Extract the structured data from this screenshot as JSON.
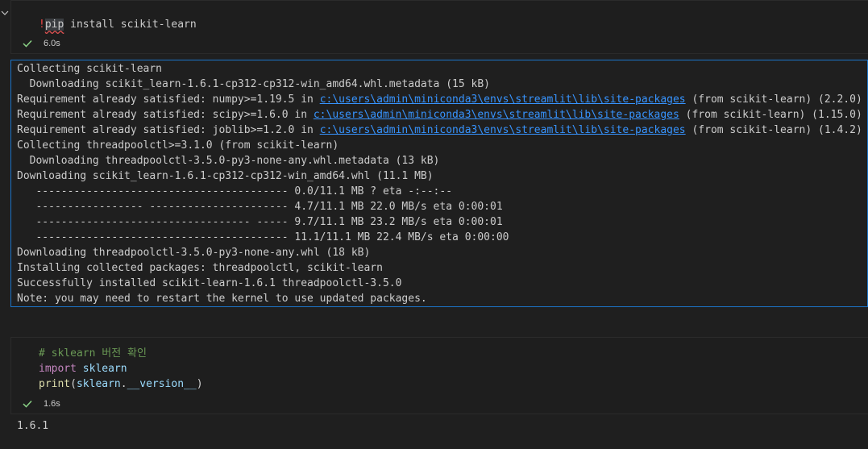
{
  "cell1": {
    "code_bang": "!",
    "code_pip": "pip",
    "code_rest": " install scikit-learn",
    "status_time": "6.0s"
  },
  "output1": {
    "lines": [
      {
        "before": "Collecting scikit-learn"
      },
      {
        "before": "  Downloading scikit_learn-1.6.1-cp312-cp312-win_amd64.whl.metadata (15 kB)"
      },
      {
        "before": "Requirement already satisfied: numpy>=1.19.5 in ",
        "link": "c:\\users\\admin\\miniconda3\\envs\\streamlit\\lib\\site-packages",
        "after": " (from scikit-learn) (2.2.0)"
      },
      {
        "before": "Requirement already satisfied: scipy>=1.6.0 in ",
        "link": "c:\\users\\admin\\miniconda3\\envs\\streamlit\\lib\\site-packages",
        "after": " (from scikit-learn) (1.15.0)"
      },
      {
        "before": "Requirement already satisfied: joblib>=1.2.0 in ",
        "link": "c:\\users\\admin\\miniconda3\\envs\\streamlit\\lib\\site-packages",
        "after": " (from scikit-learn) (1.4.2)"
      },
      {
        "before": "Collecting threadpoolctl>=3.1.0 (from scikit-learn)"
      },
      {
        "before": "  Downloading threadpoolctl-3.5.0-py3-none-any.whl.metadata (13 kB)"
      },
      {
        "before": "Downloading scikit_learn-1.6.1-cp312-cp312-win_amd64.whl (11.1 MB)"
      },
      {
        "before": "   ---------------------------------------- 0.0/11.1 MB ? eta -:--:--"
      },
      {
        "before": "   ----------------- ---------------------- 4.7/11.1 MB 22.0 MB/s eta 0:00:01"
      },
      {
        "before": "   ---------------------------------- ----- 9.7/11.1 MB 23.2 MB/s eta 0:00:01"
      },
      {
        "before": "   ---------------------------------------- 11.1/11.1 MB 22.4 MB/s eta 0:00:00"
      },
      {
        "before": "Downloading threadpoolctl-3.5.0-py3-none-any.whl (18 kB)"
      },
      {
        "before": "Installing collected packages: threadpoolctl, scikit-learn"
      },
      {
        "before": "Successfully installed scikit-learn-1.6.1 threadpoolctl-3.5.0"
      },
      {
        "before": "Note: you may need to restart the kernel to use updated packages."
      }
    ]
  },
  "cell2": {
    "comment": "# sklearn 버전 확인",
    "kw_import": "import",
    "module": "sklearn",
    "fn_print": "print",
    "paren_open": "(",
    "arg_module": "sklearn",
    "dot": ".",
    "attr": "__version__",
    "paren_close": ")",
    "status_time": "1.6s"
  },
  "output2": {
    "text": "1.6.1"
  },
  "colors": {
    "background": "#1f1f1f",
    "output_border": "#1b74c8",
    "link": "#3794ff",
    "check": "#89d185"
  }
}
